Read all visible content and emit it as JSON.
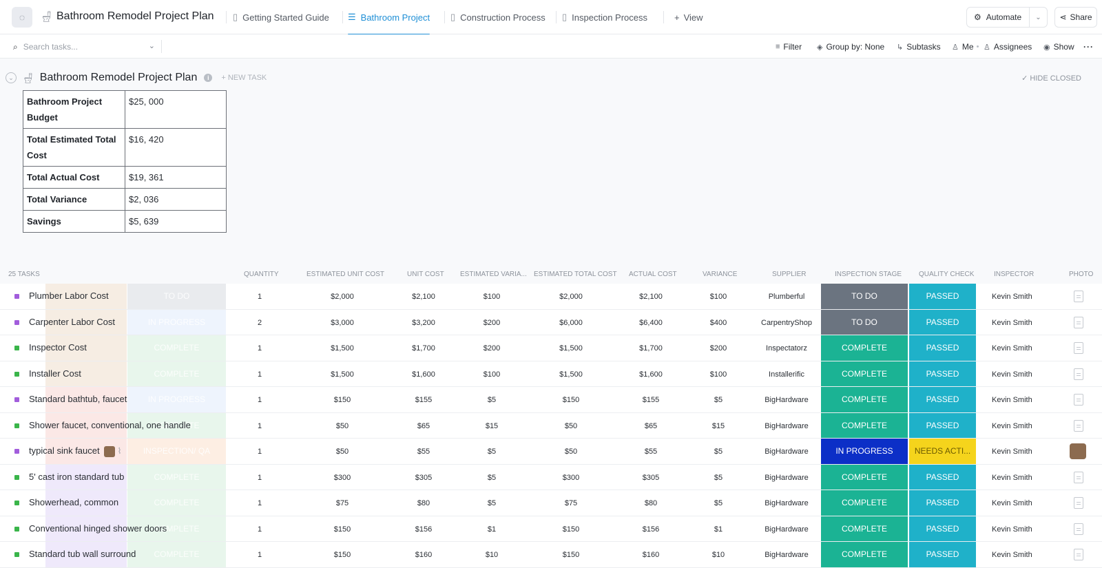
{
  "header": {
    "list_icon": "toilet-icon",
    "title": "Bathroom Remodel Project Plan",
    "tabs": [
      {
        "label": "Getting Started Guide",
        "icon": "doc-icon",
        "active": false
      },
      {
        "label": "Bathroom Project",
        "icon": "list-icon",
        "active": true
      },
      {
        "label": "Construction Process",
        "icon": "doc-icon",
        "active": false
      },
      {
        "label": "Inspection Process",
        "icon": "doc-icon",
        "active": false
      }
    ],
    "add_view_label": "View",
    "automate_label": "Automate",
    "share_label": "Share"
  },
  "toolbar": {
    "search_placeholder": "Search tasks...",
    "filter_label": "Filter",
    "group_by_label": "Group by: None",
    "subtasks_label": "Subtasks",
    "me_label": "Me",
    "assignees_label": "Assignees",
    "show_label": "Show"
  },
  "group": {
    "title": "Bathroom Remodel Project Plan",
    "new_task_label": "+ NEW TASK",
    "hide_closed_label": "HIDE CLOSED"
  },
  "budget": [
    {
      "label": "Bathroom Project Budget",
      "value": "$25, 000"
    },
    {
      "label": "Total Estimated Total Cost",
      "value": "$16, 420"
    },
    {
      "label": "Total Actual Cost",
      "value": "$19, 361"
    },
    {
      "label": "Total Variance",
      "value": "$2, 036"
    },
    {
      "label": "Savings",
      "value": "$5, 639"
    }
  ],
  "table": {
    "task_count": "25 TASKS",
    "columns": [
      "QUANTITY",
      "ESTIMATED UNIT COST",
      "UNIT COST",
      "ESTIMATED VARIA...",
      "ESTIMATED TOTAL COST",
      "ACTUAL COST",
      "VARIANCE",
      "SUPPLIER",
      "INSPECTION STAGE",
      "QUALITY CHECK",
      "INSPECTOR",
      "PHOTO"
    ],
    "rows": [
      {
        "name": "Plumber Labor Cost",
        "sq": "#a25ddc",
        "ghost": "TO DO",
        "ga": "#f6ede3",
        "gb": "#e9ebee",
        "qty": "1",
        "est_unit": "$2,000",
        "unit": "$2,100",
        "est_var": "$100",
        "est_total": "$2,000",
        "actual": "$2,100",
        "variance": "$100",
        "supplier": "Plumberful",
        "stage": "TO DO",
        "stage_color": "#6b7480",
        "qc": "PASSED",
        "qc_color": "#1fb1c9",
        "qc_text": "#ffffff",
        "inspector": "Kevin Smith",
        "photo": false
      },
      {
        "name": "Carpenter Labor Cost",
        "sq": "#a25ddc",
        "ghost": "IN PROGRESS",
        "ga": "#f6ede3",
        "gb": "#eef4fd",
        "qty": "2",
        "est_unit": "$3,000",
        "unit": "$3,200",
        "est_var": "$200",
        "est_total": "$6,000",
        "actual": "$6,400",
        "variance": "$400",
        "supplier": "CarpentryShop",
        "stage": "TO DO",
        "stage_color": "#6b7480",
        "qc": "PASSED",
        "qc_color": "#1fb1c9",
        "qc_text": "#ffffff",
        "inspector": "Kevin Smith",
        "photo": false
      },
      {
        "name": "Inspector Cost",
        "sq": "#3ab54a",
        "ghost": "COMPLETE",
        "ga": "#f6ede3",
        "gb": "#e8f6ec",
        "qty": "1",
        "est_unit": "$1,500",
        "unit": "$1,700",
        "est_var": "$200",
        "est_total": "$1,500",
        "actual": "$1,700",
        "variance": "$200",
        "supplier": "Inspectatorz",
        "stage": "COMPLETE",
        "stage_color": "#1bb394",
        "qc": "PASSED",
        "qc_color": "#1fb1c9",
        "qc_text": "#ffffff",
        "inspector": "Kevin Smith",
        "photo": false
      },
      {
        "name": "Installer Cost",
        "sq": "#3ab54a",
        "ghost": "COMPLETE",
        "ga": "#f6ede3",
        "gb": "#e8f6ec",
        "qty": "1",
        "est_unit": "$1,500",
        "unit": "$1,600",
        "est_var": "$100",
        "est_total": "$1,500",
        "actual": "$1,600",
        "variance": "$100",
        "supplier": "Installerific",
        "stage": "COMPLETE",
        "stage_color": "#1bb394",
        "qc": "PASSED",
        "qc_color": "#1fb1c9",
        "qc_text": "#ffffff",
        "inspector": "Kevin Smith",
        "photo": false
      },
      {
        "name": "Standard bathtub, faucet",
        "sq": "#a25ddc",
        "ghost": "IN PROGRESS",
        "ga": "#fbe8e6",
        "gb": "#eef4fd",
        "qty": "1",
        "est_unit": "$150",
        "unit": "$155",
        "est_var": "$5",
        "est_total": "$150",
        "actual": "$155",
        "variance": "$5",
        "supplier": "BigHardware",
        "stage": "COMPLETE",
        "stage_color": "#1bb394",
        "qc": "PASSED",
        "qc_color": "#1fb1c9",
        "qc_text": "#ffffff",
        "inspector": "Kevin Smith",
        "photo": false
      },
      {
        "name": "Shower faucet, conventional, one handle",
        "sq": "#3ab54a",
        "ghost": "COMPLETE",
        "ga": "#fbe8e6",
        "gb": "#e8f6ec",
        "qty": "1",
        "est_unit": "$50",
        "unit": "$65",
        "est_var": "$15",
        "est_total": "$50",
        "actual": "$65",
        "variance": "$15",
        "supplier": "BigHardware",
        "stage": "COMPLETE",
        "stage_color": "#1bb394",
        "qc": "PASSED",
        "qc_color": "#1fb1c9",
        "qc_text": "#ffffff",
        "inspector": "Kevin Smith",
        "photo": false
      },
      {
        "name": "typical sink faucet",
        "sq": "#a25ddc",
        "ghost": "INSPECTION/ QA",
        "ga": "#fbe8e6",
        "gb": "#fdeee3",
        "qty": "1",
        "est_unit": "$50",
        "unit": "$55",
        "est_var": "$5",
        "est_total": "$50",
        "actual": "$55",
        "variance": "$5",
        "supplier": "BigHardware",
        "stage": "IN PROGRESS",
        "stage_color": "#0c2fc7",
        "qc": "NEEDS ACTI...",
        "qc_color": "#f5d41c",
        "qc_text": "#6b5a00",
        "inspector": "Kevin Smith",
        "photo": true,
        "attachment": true
      },
      {
        "name": "5' cast iron standard tub",
        "sq": "#3ab54a",
        "ghost": "COMPLETE",
        "ga": "#efe9fb",
        "gb": "#e8f6ec",
        "qty": "1",
        "est_unit": "$300",
        "unit": "$305",
        "est_var": "$5",
        "est_total": "$300",
        "actual": "$305",
        "variance": "$5",
        "supplier": "BigHardware",
        "stage": "COMPLETE",
        "stage_color": "#1bb394",
        "qc": "PASSED",
        "qc_color": "#1fb1c9",
        "qc_text": "#ffffff",
        "inspector": "Kevin Smith",
        "photo": false
      },
      {
        "name": "Showerhead, common",
        "sq": "#3ab54a",
        "ghost": "COMPLETE",
        "ga": "#efe9fb",
        "gb": "#e8f6ec",
        "qty": "1",
        "est_unit": "$75",
        "unit": "$80",
        "est_var": "$5",
        "est_total": "$75",
        "actual": "$80",
        "variance": "$5",
        "supplier": "BigHardware",
        "stage": "COMPLETE",
        "stage_color": "#1bb394",
        "qc": "PASSED",
        "qc_color": "#1fb1c9",
        "qc_text": "#ffffff",
        "inspector": "Kevin Smith",
        "photo": false
      },
      {
        "name": "Conventional hinged shower doors",
        "sq": "#3ab54a",
        "ghost": "COMPLETE",
        "ga": "#efe9fb",
        "gb": "#e8f6ec",
        "qty": "1",
        "est_unit": "$150",
        "unit": "$156",
        "est_var": "$1",
        "est_total": "$150",
        "actual": "$156",
        "variance": "$1",
        "supplier": "BigHardware",
        "stage": "COMPLETE",
        "stage_color": "#1bb394",
        "qc": "PASSED",
        "qc_color": "#1fb1c9",
        "qc_text": "#ffffff",
        "inspector": "Kevin Smith",
        "photo": false
      },
      {
        "name": "Standard tub wall surround",
        "sq": "#3ab54a",
        "ghost": "COMPLETE",
        "ga": "#efe9fb",
        "gb": "#e8f6ec",
        "qty": "1",
        "est_unit": "$150",
        "unit": "$160",
        "est_var": "$10",
        "est_total": "$150",
        "actual": "$160",
        "variance": "$10",
        "supplier": "BigHardware",
        "stage": "COMPLETE",
        "stage_color": "#1bb394",
        "qc": "PASSED",
        "qc_color": "#1fb1c9",
        "qc_text": "#ffffff",
        "inspector": "Kevin Smith",
        "photo": false
      }
    ]
  }
}
